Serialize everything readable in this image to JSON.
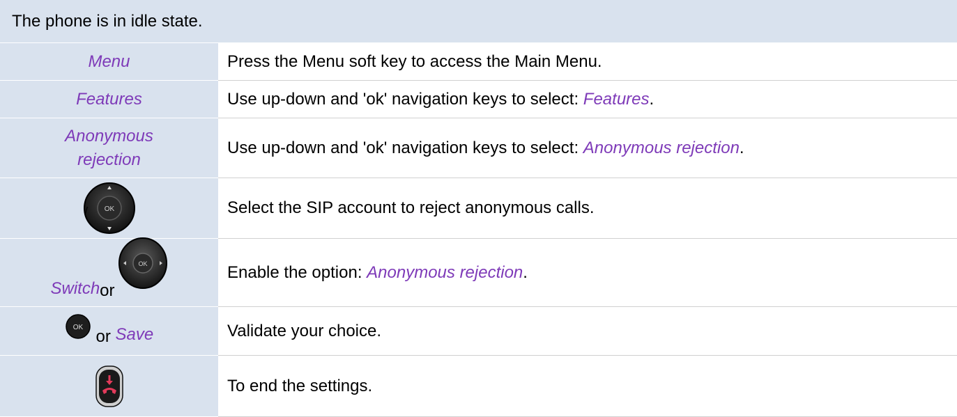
{
  "header": {
    "text": "The phone is in idle state."
  },
  "rows": [
    {
      "key": "Menu",
      "desc": "Press the Menu soft key to access the Main Menu."
    },
    {
      "key": "Features",
      "desc_prefix": "Use up-down and 'ok' navigation keys to select: ",
      "desc_em": "Features",
      "desc_suffix": "."
    },
    {
      "key_line1": "Anonymous",
      "key_line2": "rejection",
      "desc_prefix": "Use up-down and 'ok' navigation keys to select: ",
      "desc_em": "Anonymous rejection",
      "desc_suffix": "."
    },
    {
      "key_icon": "ok-nav-key-icon",
      "desc": "Select the SIP account to reject anonymous calls."
    },
    {
      "key_em": "Switch",
      "key_or": " or",
      "key_icon": "ok-left-right-key-icon",
      "desc_prefix": "Enable the option: ",
      "desc_em": "Anonymous rejection",
      "desc_suffix": "."
    },
    {
      "key_icon": "ok-key-icon",
      "key_or": " or ",
      "key_em": "Save",
      "desc": "Validate your choice."
    },
    {
      "key_icon": "end-call-key-icon",
      "desc": "To end the settings."
    }
  ],
  "colors": {
    "header_bg": "#d9e2ee",
    "accent_text": "#7e3ab8",
    "hangup_red": "#e23a5a"
  }
}
